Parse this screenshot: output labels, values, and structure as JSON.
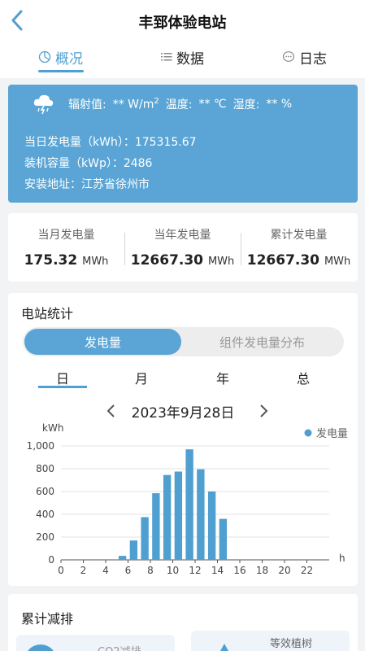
{
  "header": {
    "title": "丰郅体验电站"
  },
  "tabs": [
    {
      "label": "概况",
      "icon": "pie-chart-icon",
      "active": true
    },
    {
      "label": "数据",
      "icon": "list-icon",
      "active": false
    },
    {
      "label": "日志",
      "icon": "chat-icon",
      "active": false
    }
  ],
  "weather": {
    "icon": "thunderstorm-icon",
    "radiation_label": "辐射值:",
    "radiation_value": "** W/m",
    "radiation_sup": "2",
    "temp_label": "温度:",
    "temp_value": "** ℃",
    "humidity_label": "湿度:",
    "humidity_value": "** %",
    "daily_gen": "当日发电量（kWh）：175315.67",
    "capacity": "装机容量（kWp）：2486",
    "address": "安装地址：江苏省徐州市"
  },
  "summary": [
    {
      "label": "当月发电量",
      "value": "175.32",
      "unit": "MWh"
    },
    {
      "label": "当年发电量",
      "value": "12667.30",
      "unit": "MWh"
    },
    {
      "label": "累计发电量",
      "value": "12667.30",
      "unit": "MWh"
    }
  ],
  "stats": {
    "title": "电站统计",
    "seg_active": "发电量",
    "seg_inactive": "组件发电量分布",
    "periods": [
      "日",
      "月",
      "年",
      "总"
    ],
    "date": "2023年9月28日"
  },
  "chart_data": {
    "type": "bar",
    "xlabel": "h",
    "ylabel": "kWh",
    "legend": "发电量",
    "legend_position": "top-right",
    "ylim": [
      0,
      1000
    ],
    "yticks": [
      0,
      200,
      400,
      600,
      800,
      1000
    ],
    "ytick_labels": [
      "0",
      "200",
      "400",
      "600",
      "800",
      "1,000"
    ],
    "xticks": [
      0,
      2,
      4,
      6,
      8,
      10,
      12,
      14,
      16,
      18,
      20,
      22
    ],
    "x": [
      0,
      1,
      2,
      3,
      4,
      5,
      6,
      7,
      8,
      9,
      10,
      11,
      12,
      13,
      14,
      15,
      16,
      17,
      18,
      19,
      20,
      21,
      22,
      23
    ],
    "values": [
      0,
      0,
      0,
      0,
      0,
      35,
      170,
      375,
      585,
      745,
      775,
      970,
      795,
      600,
      360,
      0,
      0,
      0,
      0,
      0,
      0,
      0,
      0,
      0
    ],
    "bar_color": "#4f9fd1",
    "grid": true
  },
  "reduction": {
    "title": "累计减排",
    "tile1_label": "CO2减排",
    "tile2_label": "等效植树"
  }
}
